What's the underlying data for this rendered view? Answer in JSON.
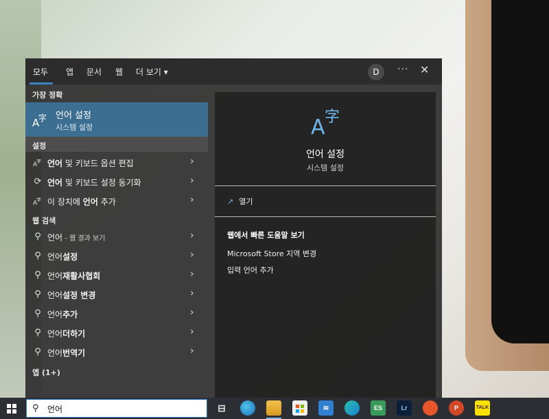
{
  "tabs": {
    "all": "모두",
    "apps": "앱",
    "documents": "문서",
    "web": "웹",
    "more": "더 보기 ▾",
    "avatar_initial": "D",
    "more_options": "···",
    "close": "✕"
  },
  "left": {
    "best_match_header": "가장 정확",
    "best_match": {
      "title": "언어 설정",
      "subtitle": "시스템 설정"
    },
    "settings_header": "설정",
    "settings_items": [
      {
        "pre": "",
        "bold": "언어",
        "post": " 및 키보드 옵션 편집"
      },
      {
        "pre": "",
        "bold": "언어",
        "post": " 및 키보드 설정 동기화"
      },
      {
        "pre": "이 장치에 ",
        "bold": "언어",
        "post": " 추가"
      }
    ],
    "web_header": "웹 검색",
    "web_items": [
      {
        "main": "언어",
        "sub": " - 웹 결과 보기"
      },
      {
        "pre": "언어",
        "bold": "설정"
      },
      {
        "pre": "언어",
        "bold": "재활사협회"
      },
      {
        "pre": "언어",
        "bold": "설정 변경"
      },
      {
        "pre": "언어",
        "bold": "추가"
      },
      {
        "pre": "언어",
        "bold": "더하기"
      },
      {
        "pre": "언어",
        "bold": "번역기"
      }
    ],
    "apps_header": "앱 (1+)"
  },
  "preview": {
    "title": "언어 설정",
    "subtitle": "시스템 설정",
    "open": "열기",
    "help_header": "웹에서 빠른 도움말 보기",
    "links": [
      "Microsoft Store 지역 변경",
      "입력 언어 추가"
    ]
  },
  "taskbar": {
    "search_value": "언어",
    "apps": [
      "task-view",
      "edge",
      "file-explorer",
      "microsoft-store",
      "mail",
      "app",
      "app",
      "lightroom",
      "app",
      "powerpoint",
      "kakaotalk"
    ],
    "labels": {
      "lr": "Lr",
      "es": "ES",
      "kakao": "TALK"
    }
  },
  "colors": {
    "accent": "#3c6e92",
    "panel": "#2e2e2e",
    "taskbar": "#2b2f33"
  }
}
